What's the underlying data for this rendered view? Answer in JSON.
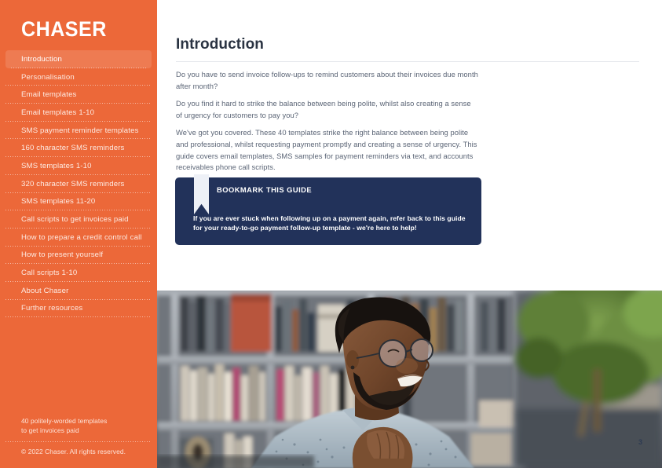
{
  "brand": {
    "logo": "CHASER"
  },
  "theme": {
    "orange": "#EC6839",
    "navy": "#22325A",
    "body_text": "#5A6475",
    "heading_text": "#2A3342"
  },
  "sidebar": {
    "items": [
      {
        "label": "Introduction",
        "active": true
      },
      {
        "label": "Personalisation",
        "active": false
      },
      {
        "label": "Email templates",
        "active": false
      },
      {
        "label": "Email templates 1-10",
        "active": false
      },
      {
        "label": "SMS payment reminder templates",
        "active": false
      },
      {
        "label": "160 character SMS reminders",
        "active": false
      },
      {
        "label": "SMS templates 1-10",
        "active": false
      },
      {
        "label": "320 character SMS reminders",
        "active": false
      },
      {
        "label": "SMS templates 11-20",
        "active": false
      },
      {
        "label": "Call scripts to get invoices paid",
        "active": false
      },
      {
        "label": "How to prepare a credit control call",
        "active": false
      },
      {
        "label": "How to present yourself",
        "active": false
      },
      {
        "label": "Call scripts 1-10",
        "active": false
      },
      {
        "label": "About Chaser",
        "active": false
      },
      {
        "label": "Further resources",
        "active": false
      }
    ],
    "footer": {
      "tagline_line1": "40 politely-worded templates",
      "tagline_line2": "to get invoices paid",
      "copyright": "© 2022 Chaser. All rights reserved."
    }
  },
  "main": {
    "title": "Introduction",
    "paragraphs": [
      "Do you have to send invoice follow-ups to remind customers about their invoices due month after month?",
      "Do you find it hard to strike the balance between being polite, whilst also creating a sense of urgency for customers to pay you?",
      "We've got you covered. These 40 templates strike the right balance between being polite and professional, whilst requesting payment promptly and creating a sense of urgency. This guide covers email templates, SMS samples for payment reminders via text, and accounts receivables phone call scripts."
    ],
    "callout": {
      "icon": "bookmark-ribbon-icon",
      "heading": "BOOKMARK THIS GUIDE",
      "body": "If you are ever stuck when following up on a payment again, refer back to this guide for your ready-to-go payment follow-up template - we're here to help!"
    },
    "hero_photo_alt": "Smiling man with glasses resting chin on hands in front of bookshelves with a plant",
    "page_number": "3"
  }
}
